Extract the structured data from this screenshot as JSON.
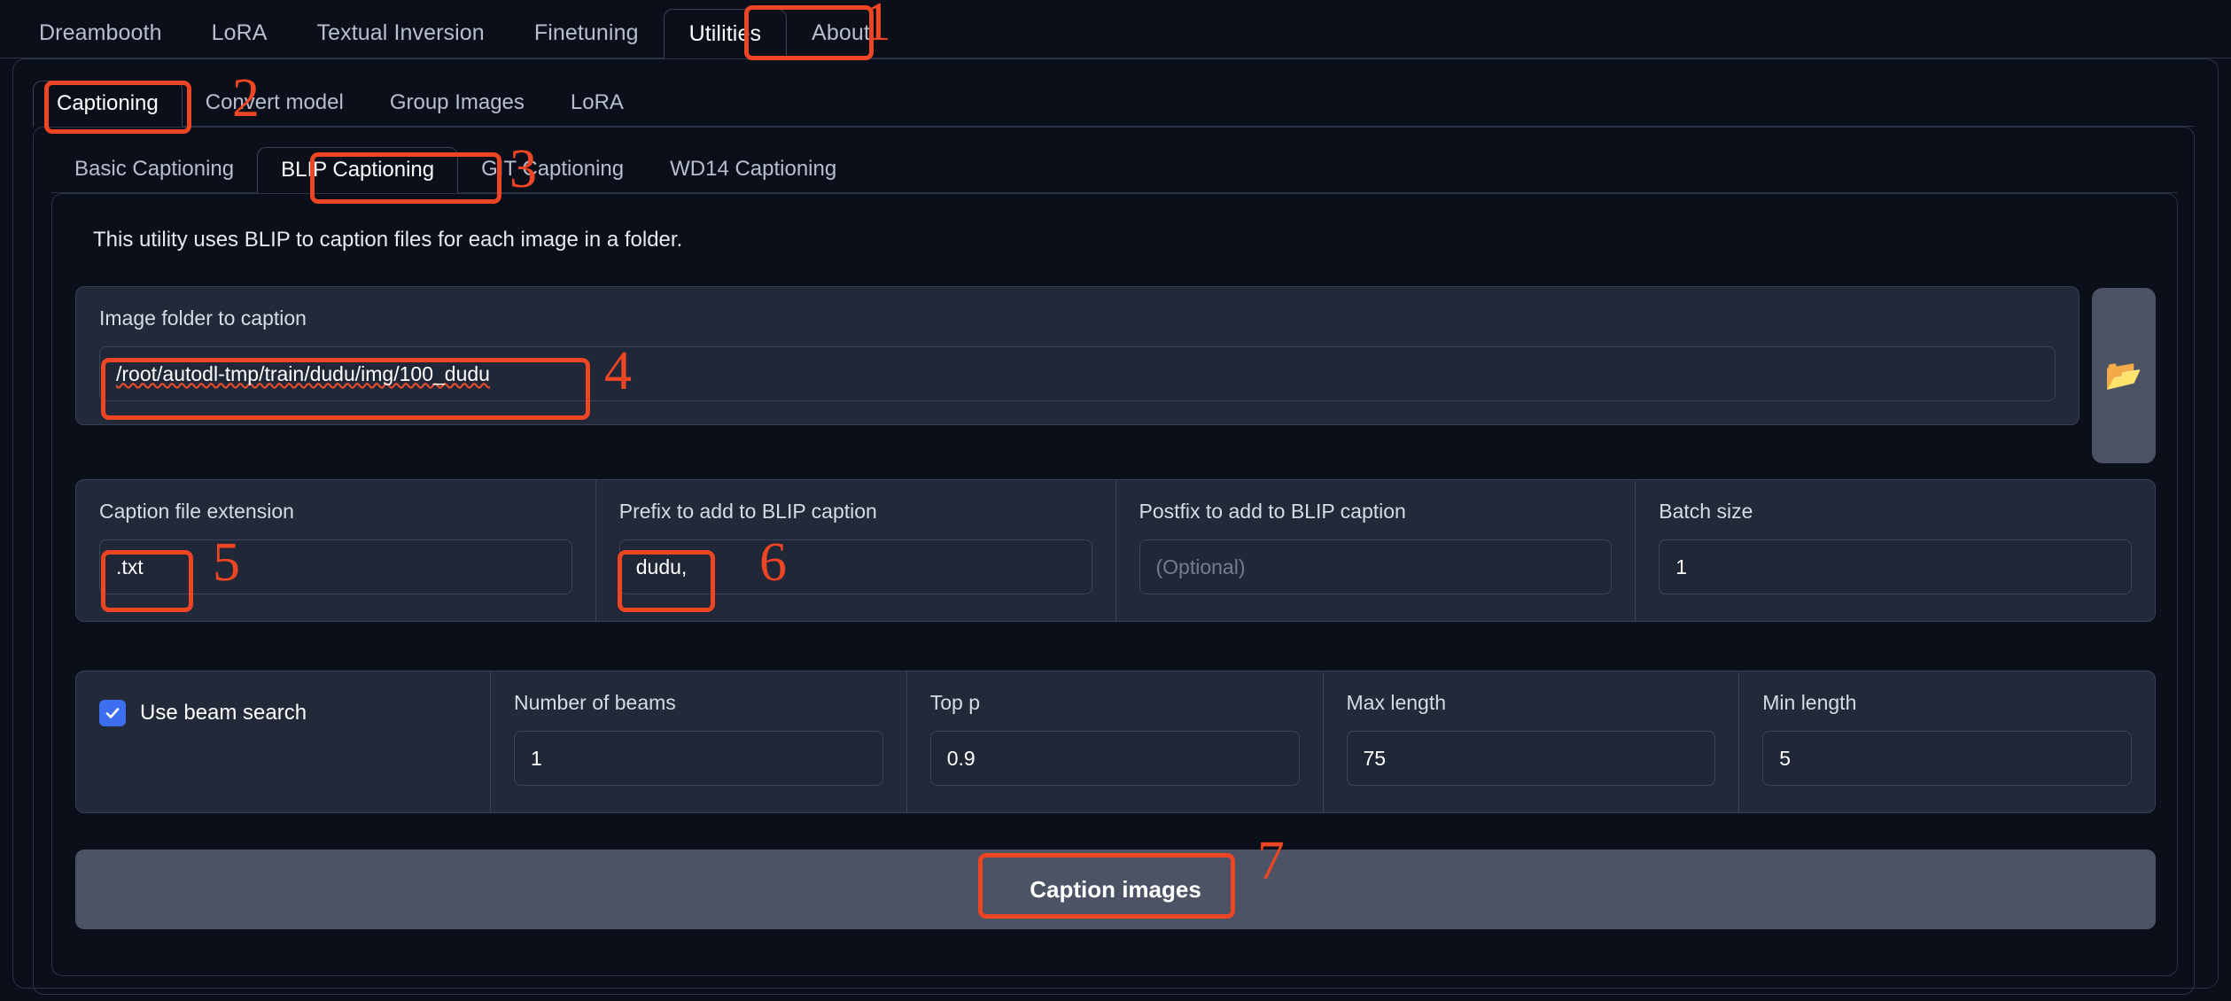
{
  "colors": {
    "annotation": "#ee4524",
    "page_bg": "#0b0f19",
    "panel_bg": "#222a3a",
    "accent_checkbox": "#3c6ef0",
    "button_bg": "#4b5364"
  },
  "tabs_level1": [
    {
      "label": "Dreambooth",
      "active": false
    },
    {
      "label": "LoRA",
      "active": false
    },
    {
      "label": "Textual Inversion",
      "active": false
    },
    {
      "label": "Finetuning",
      "active": false
    },
    {
      "label": "Utilities",
      "active": true
    },
    {
      "label": "About",
      "active": false
    }
  ],
  "tabs_level2": [
    {
      "label": "Captioning",
      "active": true
    },
    {
      "label": "Convert model",
      "active": false
    },
    {
      "label": "Group Images",
      "active": false
    },
    {
      "label": "LoRA",
      "active": false
    }
  ],
  "tabs_level3": [
    {
      "label": "Basic Captioning",
      "active": false
    },
    {
      "label": "BLIP Captioning",
      "active": true
    },
    {
      "label": "GIT Captioning",
      "active": false
    },
    {
      "label": "WD14 Captioning",
      "active": false
    }
  ],
  "description": "This utility uses BLIP to caption files for each image in a folder.",
  "folder": {
    "label": "Image folder to caption",
    "value": "/root/autodl-tmp/train/dudu/img/100_dudu",
    "browse_icon": "open-folder-icon",
    "browse_glyph": "📂"
  },
  "quad_fields": [
    {
      "label": "Caption file extension",
      "value": ".txt",
      "placeholder": "",
      "name": "caption-file-extension"
    },
    {
      "label": "Prefix to add to BLIP caption",
      "value": "dudu,",
      "placeholder": "",
      "name": "prefix-field"
    },
    {
      "label": "Postfix to add to BLIP caption",
      "value": "",
      "placeholder": "(Optional)",
      "name": "postfix-field"
    },
    {
      "label": "Batch size",
      "value": "1",
      "placeholder": "",
      "name": "batch-size-field"
    }
  ],
  "beam": {
    "checkbox_label": "Use beam search",
    "checkbox_checked": true,
    "fields": [
      {
        "label": "Number of beams",
        "value": "1",
        "name": "number-of-beams-field"
      },
      {
        "label": "Top p",
        "value": "0.9",
        "name": "top-p-field"
      },
      {
        "label": "Max length",
        "value": "75",
        "name": "max-length-field"
      },
      {
        "label": "Min length",
        "value": "5",
        "name": "min-length-field"
      }
    ]
  },
  "action": {
    "label": "Caption images"
  },
  "annotations": [
    {
      "number": "1"
    },
    {
      "number": "2"
    },
    {
      "number": "3"
    },
    {
      "number": "4"
    },
    {
      "number": "5"
    },
    {
      "number": "6"
    },
    {
      "number": "7"
    }
  ]
}
